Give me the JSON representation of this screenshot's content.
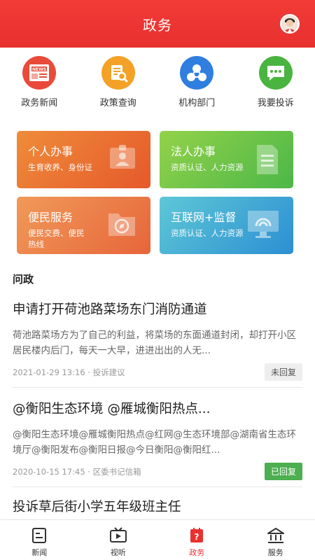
{
  "header": {
    "title": "政务"
  },
  "quicknav": [
    {
      "label": "政务新闻",
      "icon": "news-icon",
      "color": "#e94a3a",
      "badge": "NEWS"
    },
    {
      "label": "政策查询",
      "icon": "policy-search-icon",
      "color": "#f3a227"
    },
    {
      "label": "机构部门",
      "icon": "department-icon",
      "color": "#2f7ee0"
    },
    {
      "label": "我要投诉",
      "icon": "complaint-chat-icon",
      "color": "#49b43f"
    }
  ],
  "cards": [
    {
      "title": "个人办事",
      "sub": "生育收养、身份证",
      "icon": "id-card-icon",
      "color_from": "#ee8a3a",
      "color_to": "#e55a2b"
    },
    {
      "title": "法人办事",
      "sub": "资质认证、人力资源",
      "icon": "document-icon",
      "color_from": "#92d04a",
      "color_to": "#4fb848"
    },
    {
      "title": "便民服务",
      "sub": "便民交费、便民热线",
      "icon": "folder-compass-icon",
      "color_from": "#ef9a5a",
      "color_to": "#e8663a"
    },
    {
      "title": "互联网+监督",
      "sub": "资质认证、人力资源",
      "icon": "monitor-icon",
      "color_from": "#5cc6d8",
      "color_to": "#2b8fd3"
    }
  ],
  "section": {
    "title": "问政"
  },
  "feed": [
    {
      "title": "申请打开荷池路菜场东门消防通道",
      "body": "荷池路菜场方为了自己的利益，将菜场的东面通道封闭，却打开小区居民楼内后门，每天一大早，进进出出的人无...",
      "meta": "2021-01-29 13:16 · 投诉建议",
      "status": "未回复"
    },
    {
      "title": "@衡阳生态环境 @雁城衡阳热点...",
      "body": "@衡阳生态环境@雁城衡阳热点@红网@生态环境部@湖南省生态环境厅@衡阳发布@衡阳日报@今日衡阳@衡阳红...",
      "meta": "2020-10-15 17:45 · 区委书记信箱",
      "status": "已回复"
    },
    {
      "title": "投诉草后街小学五年级班主任"
    }
  ],
  "tabbar": [
    {
      "label": "新闻",
      "icon": "news-tab-icon"
    },
    {
      "label": "视听",
      "icon": "video-tab-icon"
    },
    {
      "label": "政务",
      "icon": "government-tab-icon",
      "active": true
    },
    {
      "label": "服务",
      "icon": "service-tab-icon"
    }
  ]
}
